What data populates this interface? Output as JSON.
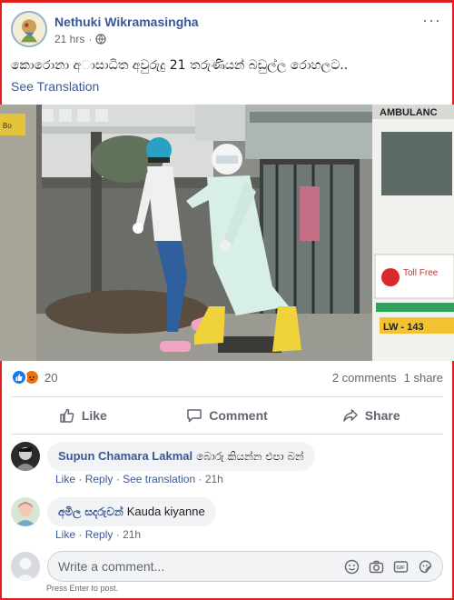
{
  "post": {
    "author": "Nethuki Wikramasingha",
    "time": "21 hrs",
    "separator": "·",
    "text": "කොරොනා අාසාධිත අවුරුදු 21 තරුණියන් බඩුල්ල රොහලට..",
    "see_translation": "See Translation",
    "more": "···"
  },
  "photo": {
    "ambulance_text": "AMBULANC",
    "toll_text": "Toll Free",
    "plate_text": "LW - 143",
    "sign_text": "Bo"
  },
  "reactions": {
    "count": "20"
  },
  "stats": {
    "comments": "2 comments",
    "shares": "1 share"
  },
  "actions": {
    "like": "Like",
    "comment": "Comment",
    "share": "Share"
  },
  "comments": [
    {
      "name": "Supun Chamara Lakmal",
      "text": "බොරු කියන්න එපා බන්",
      "like": "Like",
      "reply": "Reply",
      "translate": "See translation",
      "time": "21h",
      "sep": "·"
    },
    {
      "name": "අමිල සදරුවන්",
      "text": "Kauda kiyanne",
      "like": "Like",
      "reply": "Reply",
      "time": "21h",
      "sep": "·"
    }
  ],
  "composer": {
    "placeholder": "Write a comment...",
    "hint": "Press Enter to post."
  },
  "colors": {
    "link": "#385898",
    "like_blue": "#1877f2",
    "angry_orange": "#e9710f",
    "frame_red": "#e02020"
  }
}
